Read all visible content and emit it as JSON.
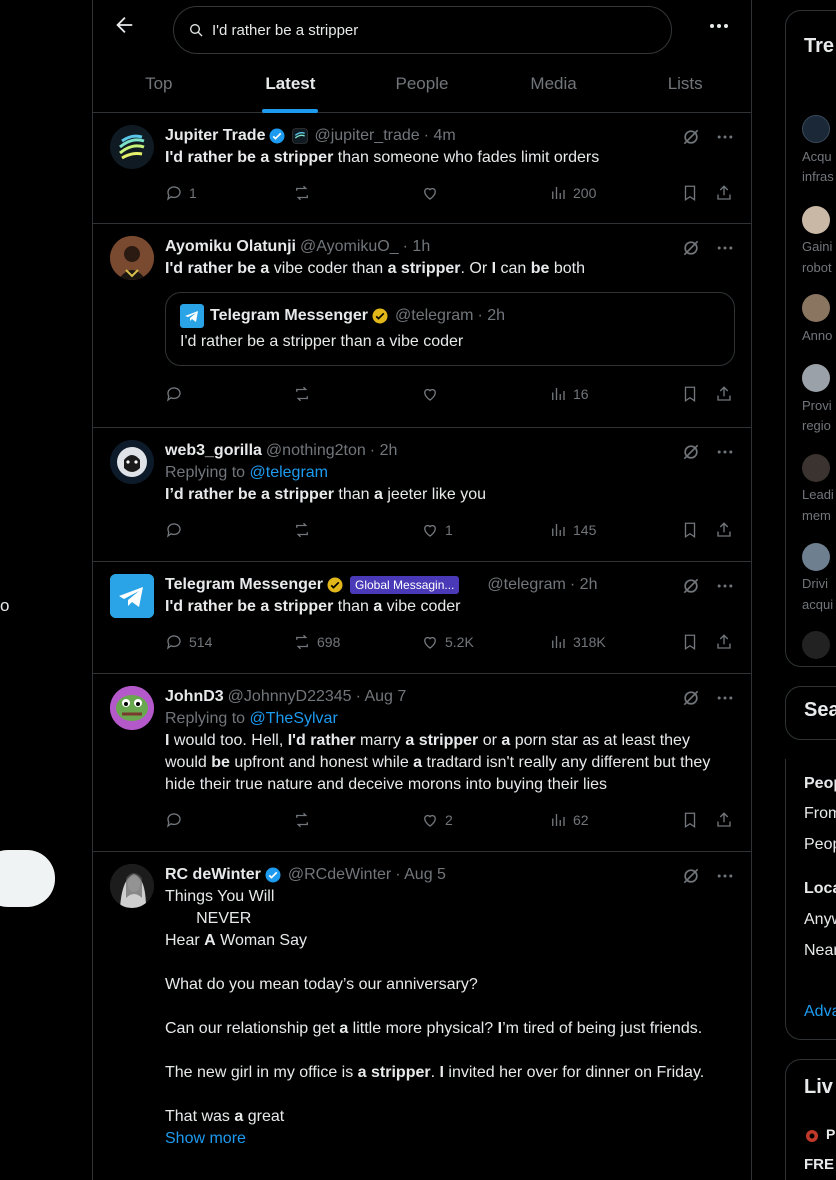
{
  "search": {
    "value": "I'd rather be a stripper"
  },
  "tabs": [
    "Top",
    "Latest",
    "People",
    "Media",
    "Lists"
  ],
  "left": {
    "fragment": "o"
  },
  "posts": [
    {
      "name": "Jupiter Trade",
      "handle": "@jupiter_trade",
      "time": "· 4m",
      "replies": "1",
      "reposts": "",
      "likes": "",
      "views": "200"
    },
    {
      "name": "Ayomiku Olatunji",
      "handle": "@AyomikuO_",
      "time": "· 1h",
      "replies": "",
      "reposts": "",
      "likes": "",
      "views": "16",
      "quote": {
        "name": "Telegram Messenger",
        "handle": "@telegram",
        "time": "· 2h",
        "text": "I'd rather be a stripper than a vibe coder"
      }
    },
    {
      "name": "web3_gorilla",
      "handle": "@nothing2ton",
      "time": "· 2h",
      "reply_prefix": "Replying to",
      "reply_to": "@telegram",
      "replies": "",
      "reposts": "",
      "likes": "1",
      "views": "145"
    },
    {
      "name": "Telegram Messenger",
      "affiliation": "Global Messagin...",
      "handle": "@telegram",
      "time": "· 2h",
      "replies": "514",
      "reposts": "698",
      "likes": "5.2K",
      "views": "318K"
    },
    {
      "name": "JohnD3",
      "handle": "@JohnnyD22345",
      "time": "· Aug 7",
      "reply_prefix": "Replying to",
      "reply_to": "@TheSylvar",
      "replies": "",
      "reposts": "",
      "likes": "2",
      "views": "62"
    },
    {
      "name": "RC deWinter",
      "handle": "@RCdeWinter",
      "time": "· Aug 5",
      "show_more": "Show more"
    }
  ],
  "right": {
    "trends_title": "Tre",
    "news": [
      "Acqu",
      "infras",
      "Gaini",
      "robot",
      "Anno",
      "Provi",
      "regio",
      "Leadi",
      "mem",
      "Drivi",
      "acqui"
    ],
    "search_title": "Sea",
    "filters": {
      "people": "Peop",
      "from": "From",
      "people2": "Peop",
      "location": "Loca",
      "anywhere": "Anyw",
      "near": "Near",
      "advanced": "Adva"
    },
    "live_title": "Liv",
    "live_line1": "P",
    "live_line2": "FRE"
  },
  "colors": {
    "accent": "#1d9bf0",
    "border": "#2f3336",
    "muted": "#71767b",
    "text": "#e7e9ea",
    "gold": "#e2b719"
  }
}
